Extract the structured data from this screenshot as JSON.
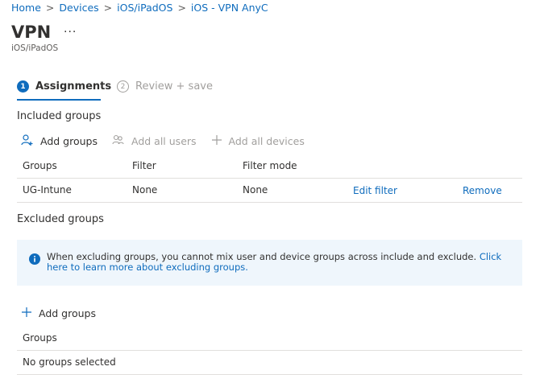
{
  "breadcrumb": [
    "Home",
    "Devices",
    "iOS/iPadOS",
    "iOS - VPN AnyC"
  ],
  "breadcrumb_separator": ">",
  "page": {
    "title": "VPN",
    "more_label": "...",
    "subtitle": "iOS/iPadOS"
  },
  "steps": [
    {
      "number": "1",
      "label": "Assignments",
      "active": true
    },
    {
      "number": "2",
      "label": "Review + save",
      "active": false
    }
  ],
  "included": {
    "heading": "Included groups",
    "commands": {
      "add_groups": "Add groups",
      "add_all_users": "Add all users",
      "add_all_devices": "Add all devices"
    },
    "columns": {
      "groups": "Groups",
      "filter": "Filter",
      "filter_mode": "Filter mode"
    },
    "rows": [
      {
        "group": "UG-Intune",
        "filter": "None",
        "filter_mode": "None",
        "edit": "Edit filter",
        "remove": "Remove"
      }
    ]
  },
  "excluded": {
    "heading": "Excluded groups",
    "info_text": "When excluding groups, you cannot mix user and device groups across include and exclude. ",
    "info_link": "Click here to learn more about excluding groups.",
    "add_groups": "Add groups",
    "column_groups": "Groups",
    "empty_text": "No groups selected"
  },
  "colors": {
    "accent": "#0f6cbd",
    "info_background": "#eff6fc",
    "disabled": "#a19f9d"
  },
  "icons": [
    "add-user-icon",
    "add-all-users-icon",
    "plus-icon",
    "info-icon"
  ]
}
